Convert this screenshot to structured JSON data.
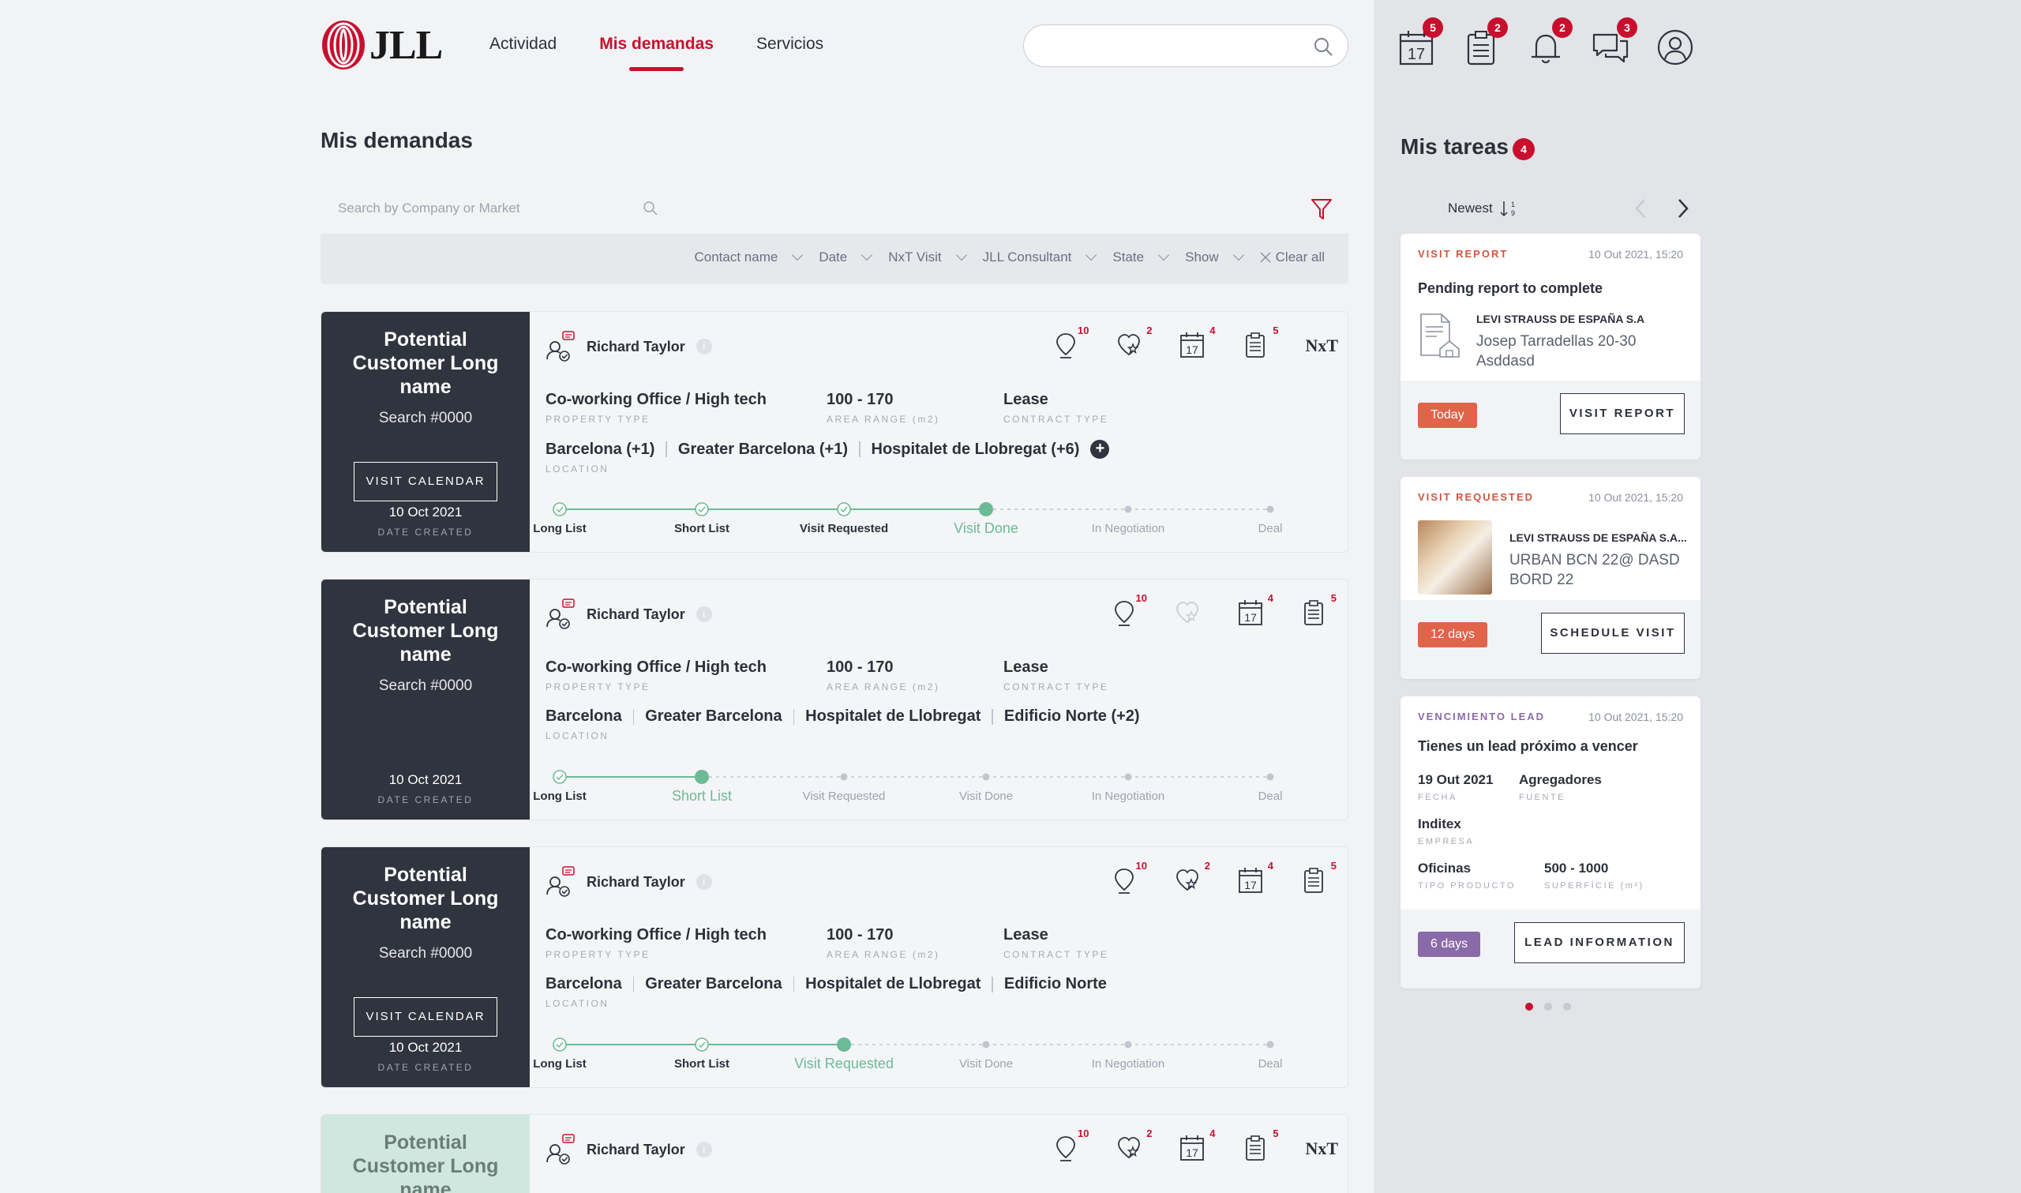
{
  "brand": {
    "logo_text": "JLL"
  },
  "nav": {
    "items": [
      "Actividad",
      "Mis demandas",
      "Servicios"
    ],
    "active": "Mis demandas"
  },
  "global_search": {
    "placeholder": ""
  },
  "page_title": "Mis demandas",
  "company_search": {
    "placeholder": "Search by Company or Market"
  },
  "filters": {
    "items": [
      "Contact name",
      "Date",
      "NxT Visit",
      "JLL Consultant",
      "State",
      "Show"
    ],
    "clear": "Clear all"
  },
  "labels": {
    "property_type": "PROPERTY TYPE",
    "area_range": "AREA RANGE (m2)",
    "contract_type": "CONTRACT TYPE",
    "location": "LOCATION",
    "date_created": "DATE CREATED",
    "visit_calendar": "VISIT CALENDAR",
    "nxt": "NxT"
  },
  "stages": [
    "Long List",
    "Short List",
    "Visit Requested",
    "Visit Done",
    "In Negotiation",
    "Deal"
  ],
  "cards": [
    {
      "customer": "Potential Customer Long name",
      "search": "Search #0000",
      "date": "10 Oct 2021",
      "consultant": "Richard Taylor",
      "property_type": "Co-working Office / High tech",
      "area": "100 - 170",
      "contract": "Lease",
      "locations": [
        "Barcelona (+1)",
        "Greater Barcelona (+1)",
        "Hospitalet de Llobregat (+6)"
      ],
      "counts": {
        "locations": "10",
        "favorites": "2",
        "visits": "4",
        "reports": "5"
      },
      "current_stage": 3
    },
    {
      "customer": "Potential Customer Long name",
      "search": "Search #0000",
      "date": "10 Oct 2021",
      "consultant": "Richard Taylor",
      "property_type": "Co-working Office / High tech",
      "area": "100 - 170",
      "contract": "Lease",
      "locations": [
        "Barcelona",
        "Greater Barcelona",
        "Hospitalet de Llobregat",
        "Edificio Norte (+2)"
      ],
      "counts": {
        "locations": "10",
        "visits": "4",
        "reports": "5"
      },
      "current_stage": 1
    },
    {
      "customer": "Potential Customer Long name",
      "search": "Search #0000",
      "date": "10 Oct 2021",
      "consultant": "Richard Taylor",
      "property_type": "Co-working Office / High tech",
      "area": "100 - 170",
      "contract": "Lease",
      "locations": [
        "Barcelona",
        "Greater Barcelona",
        "Hospitalet de Llobregat",
        "Edificio Norte"
      ],
      "counts": {
        "locations": "10",
        "favorites": "2",
        "visits": "4",
        "reports": "5"
      },
      "current_stage": 2
    },
    {
      "customer": "Potential Customer Long name",
      "consultant": "Richard Taylor",
      "counts": {
        "locations": "10",
        "favorites": "2",
        "visits": "4",
        "reports": "5"
      }
    }
  ],
  "side_icons": {
    "calendar": "5",
    "tasks": "2",
    "notifications": "2",
    "messages": "3",
    "calendar_day": "17"
  },
  "tasks": {
    "title": "Mis tareas",
    "count": "4",
    "sort": "Newest",
    "items": [
      {
        "type": "VISIT REPORT",
        "date": "10 Out 2021, 15:20",
        "heading": "Pending report to complete",
        "company": "LEVI STRAUSS DE ESPAÑA S.A",
        "address": "Josep Tarradellas 20-30 Asddasd",
        "pill": "Today",
        "button": "VISIT REPORT"
      },
      {
        "type": "VISIT REQUESTED",
        "date": "10 Out 2021, 15:20",
        "company": "LEVI STRAUSS DE ESPAÑA S.A...",
        "address": "URBAN BCN 22@ DASD BORD 22",
        "pill": "12 days",
        "button": "SCHEDULE VISIT"
      },
      {
        "type": "VENCIMIENTO LEAD",
        "date": "10 Out 2021, 15:20",
        "heading": "Tienes un lead próximo a vencer",
        "fecha": "19 Out 2021",
        "fecha_label": "FECHA",
        "fuente": "Agregadores",
        "fuente_label": "FUENTE",
        "empresa": "Inditex",
        "empresa_label": "EMPRESA",
        "tipo": "Oficinas",
        "tipo_label": "TIPO PRODUCTO",
        "superficie": "500 - 1000",
        "superficie_label": "SUPERFÍCIE (m²)",
        "pill": "6 days",
        "button": "LEAD INFORMATION"
      }
    ]
  },
  "colors": {
    "brand_red": "#c8102e",
    "dark": "#30343f",
    "green": "#6cbb96",
    "coral": "#e0634a",
    "purple": "#8a6aa8"
  }
}
